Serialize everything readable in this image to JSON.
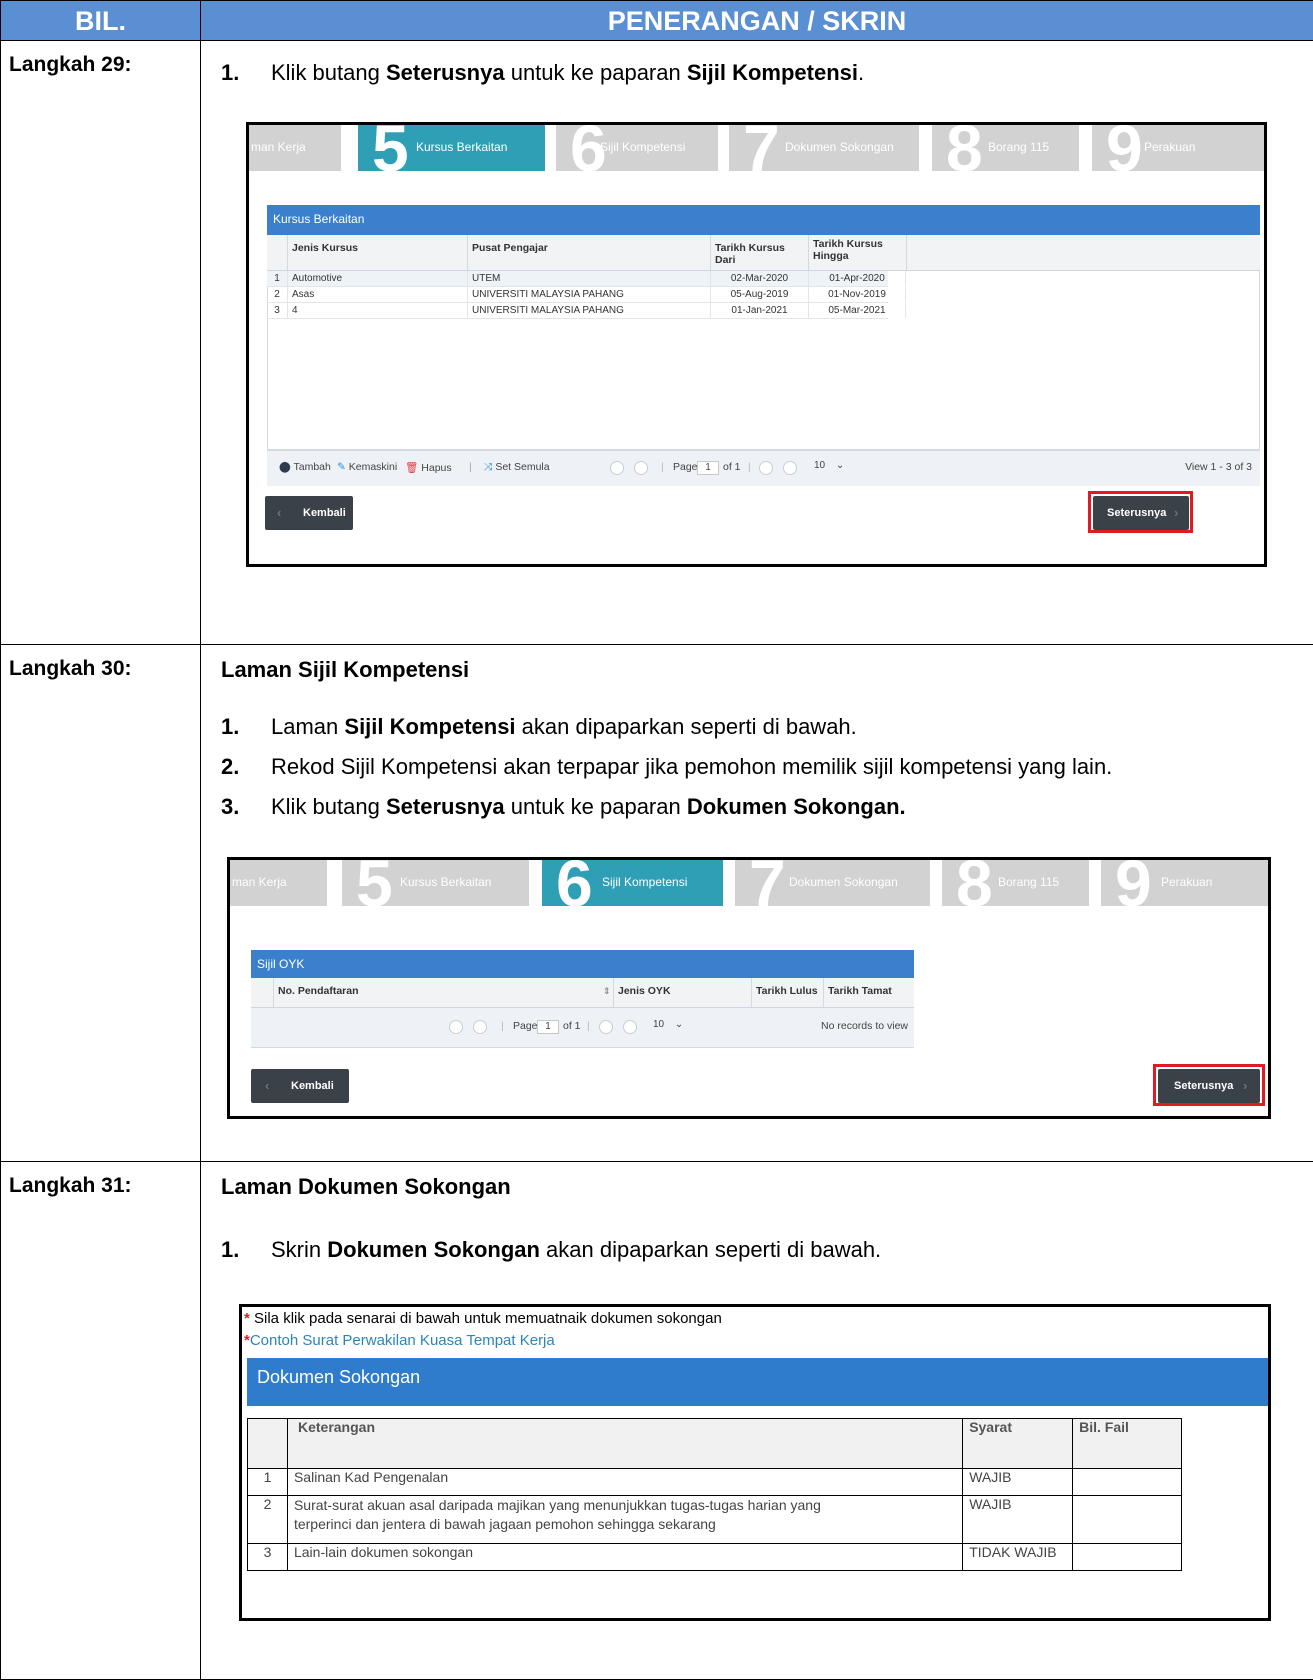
{
  "header": {
    "col1": "BIL.",
    "col2": "PENERANGAN / SKRIN"
  },
  "steps": [
    {
      "label": "Langkah 29:",
      "items": [
        {
          "num": "1.",
          "pre": "Klik butang ",
          "b1": "Seterusnya",
          "mid": " untuk ke paparan ",
          "b2": "Sijil Kompetensi",
          "post": "."
        }
      ]
    },
    {
      "label": "Langkah 30:",
      "title": "Laman Sijil Kompetensi",
      "items": [
        {
          "num": "1.",
          "pre": "Laman ",
          "b1": "Sijil Kompetensi",
          "post": " akan dipaparkan seperti di bawah."
        },
        {
          "num": "2.",
          "text": "Rekod Sijil Kompetensi akan terpapar jika pemohon memilik sijil kompetensi yang lain."
        },
        {
          "num": "3.",
          "pre": "Klik butang ",
          "b1": "Seterusnya",
          "mid": " untuk ke paparan ",
          "b2": "Dokumen Sokongan."
        }
      ]
    },
    {
      "label": "Langkah 31:",
      "title": "Laman Dokumen Sokongan",
      "items": [
        {
          "num": "1.",
          "pre": "Skrin ",
          "b1": "Dokumen Sokongan",
          "post": " akan dipaparkan seperti di bawah."
        }
      ]
    }
  ],
  "wizard": {
    "tabs": [
      {
        "num": "",
        "label": "man Kerja"
      },
      {
        "num": "5",
        "label": "Kursus Berkaitan"
      },
      {
        "num": "6",
        "label": "Sijil Kompetensi"
      },
      {
        "num": "7",
        "label": "Dokumen Sokongan"
      },
      {
        "num": "8",
        "label": "Borang 115"
      },
      {
        "num": "9",
        "label": "Perakuan"
      }
    ]
  },
  "kursus": {
    "panel_title": "Kursus Berkaitan",
    "columns": [
      "Jenis Kursus",
      "Pusat Pengajar",
      "Tarikh Kursus Dari",
      "Tarikh Kursus Hingga"
    ],
    "rows": [
      {
        "no": "1",
        "jenis": "Automotive",
        "pusat": "UTEM",
        "dari": "02-Mar-2020",
        "hingga": "01-Apr-2020"
      },
      {
        "no": "2",
        "jenis": "Asas",
        "pusat": "UNIVERSITI MALAYSIA PAHANG",
        "dari": "05-Aug-2019",
        "hingga": "01-Nov-2019"
      },
      {
        "no": "3",
        "jenis": "4",
        "pusat": "UNIVERSITI MALAYSIA PAHANG",
        "dari": "01-Jan-2021",
        "hingga": "05-Mar-2021"
      }
    ],
    "toolbar": {
      "add": "Tambah",
      "edit": "Kemaskini",
      "delete": "Hapus",
      "reset": "Set Semula"
    },
    "pager": {
      "page_label": "Page",
      "page": "1",
      "of": "of 1",
      "size": "10",
      "view": "View 1 - 3 of 3"
    }
  },
  "oyk": {
    "panel_title": "Sijil OYK",
    "columns": [
      "No. Pendaftaran",
      "Jenis OYK",
      "Tarikh Lulus",
      "Tarikh Tamat"
    ],
    "pager": {
      "page_label": "Page",
      "page": "1",
      "of": "of 1",
      "size": "10",
      "view": "No records to view"
    }
  },
  "buttons": {
    "back": "Kembali",
    "next": "Seterusnya"
  },
  "dokumen": {
    "note1": "Sila klik pada senarai di bawah untuk memuatnaik dokumen sokongan",
    "note2": "Contoh Surat Perwakilan Kuasa Tempat Kerja",
    "star": "*",
    "panel_title": "Dokumen Sokongan",
    "columns": [
      "Keterangan",
      "Syarat",
      "Bil. Fail"
    ],
    "rows": [
      {
        "no": "1",
        "ket": "Salinan Kad Pengenalan",
        "syarat": "WAJIB"
      },
      {
        "no": "2",
        "ket": "Surat-surat akuan asal daripada majikan yang menunjukkan tugas-tugas harian yang terperinci dan jentera di bawah jagaan pemohon sehingga sekarang",
        "syarat": "WAJIB"
      },
      {
        "no": "3",
        "ket": "Lain-lain dokumen sokongan",
        "syarat": "TIDAK WAJIB"
      }
    ]
  }
}
